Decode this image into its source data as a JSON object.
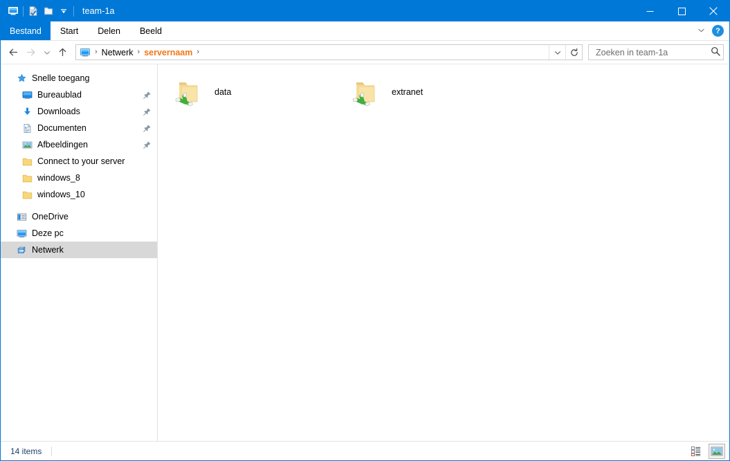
{
  "window": {
    "title": "team-1a",
    "quick_access": [
      {
        "name": "this-pc-icon",
        "label": "Deze pc"
      },
      {
        "name": "properties-icon",
        "label": "Eigenschappen"
      },
      {
        "name": "new-folder-icon",
        "label": "Nieuwe map"
      },
      {
        "name": "customize-chevron-icon",
        "label": "Werkbalk Snelle toegang aanpassen"
      }
    ],
    "controls": {
      "minimize": "–",
      "maximize": "□",
      "close": "✕"
    }
  },
  "ribbon": {
    "tabs": [
      {
        "label": "Bestand",
        "active": true
      },
      {
        "label": "Start",
        "active": false
      },
      {
        "label": "Delen",
        "active": false
      },
      {
        "label": "Beeld",
        "active": false
      }
    ],
    "collapse_label": "⌄",
    "help_label": "?"
  },
  "nav": {
    "back": "←",
    "forward": "→",
    "recent": "⌄",
    "up": "↑",
    "breadcrumb": [
      {
        "label": "Netwerk",
        "highlight": false
      },
      {
        "label": "servernaam",
        "highlight": true
      }
    ],
    "breadcrumb_separator": "›",
    "dropdown": "⌄",
    "refresh": "↻",
    "refresh_title": "Vernieuwen"
  },
  "search": {
    "placeholder": "Zoeken in team-1a",
    "value": ""
  },
  "sidebar": {
    "items": [
      {
        "label": "Snelle toegang",
        "icon": "star-icon",
        "level": 0,
        "pinned": false,
        "selected": false
      },
      {
        "label": "Bureaublad",
        "icon": "desktop-icon",
        "level": 1,
        "pinned": true,
        "selected": false
      },
      {
        "label": "Downloads",
        "icon": "downloads-icon",
        "level": 1,
        "pinned": true,
        "selected": false
      },
      {
        "label": "Documenten",
        "icon": "documents-icon",
        "level": 1,
        "pinned": true,
        "selected": false
      },
      {
        "label": "Afbeeldingen",
        "icon": "pictures-icon",
        "level": 1,
        "pinned": true,
        "selected": false
      },
      {
        "label": "Connect to your server",
        "icon": "folder-icon",
        "level": 1,
        "pinned": false,
        "selected": false
      },
      {
        "label": "windows_8",
        "icon": "folder-icon",
        "level": 1,
        "pinned": false,
        "selected": false
      },
      {
        "label": "windows_10",
        "icon": "folder-icon",
        "level": 1,
        "pinned": false,
        "selected": false
      },
      {
        "label": "OneDrive",
        "icon": "onedrive-icon",
        "level": 0,
        "pinned": false,
        "selected": false
      },
      {
        "label": "Deze pc",
        "icon": "this-pc-icon",
        "level": 0,
        "pinned": false,
        "selected": false
      },
      {
        "label": "Netwerk",
        "icon": "network-icon",
        "level": 0,
        "pinned": false,
        "selected": true
      }
    ]
  },
  "content": {
    "items": [
      {
        "label": "data",
        "icon": "shared-folder-icon"
      },
      {
        "label": "extranet",
        "icon": "shared-folder-icon"
      }
    ]
  },
  "status": {
    "count_text": "14 items",
    "views": [
      {
        "name": "details-view-button",
        "active": false
      },
      {
        "name": "large-icons-view-button",
        "active": true
      }
    ]
  },
  "colors": {
    "accent": "#0078d7",
    "highlight_orange": "#f07818",
    "selection_grey": "#d8d8d8",
    "folder_yellow": "#f7d77f",
    "network_green": "#4cb944"
  }
}
